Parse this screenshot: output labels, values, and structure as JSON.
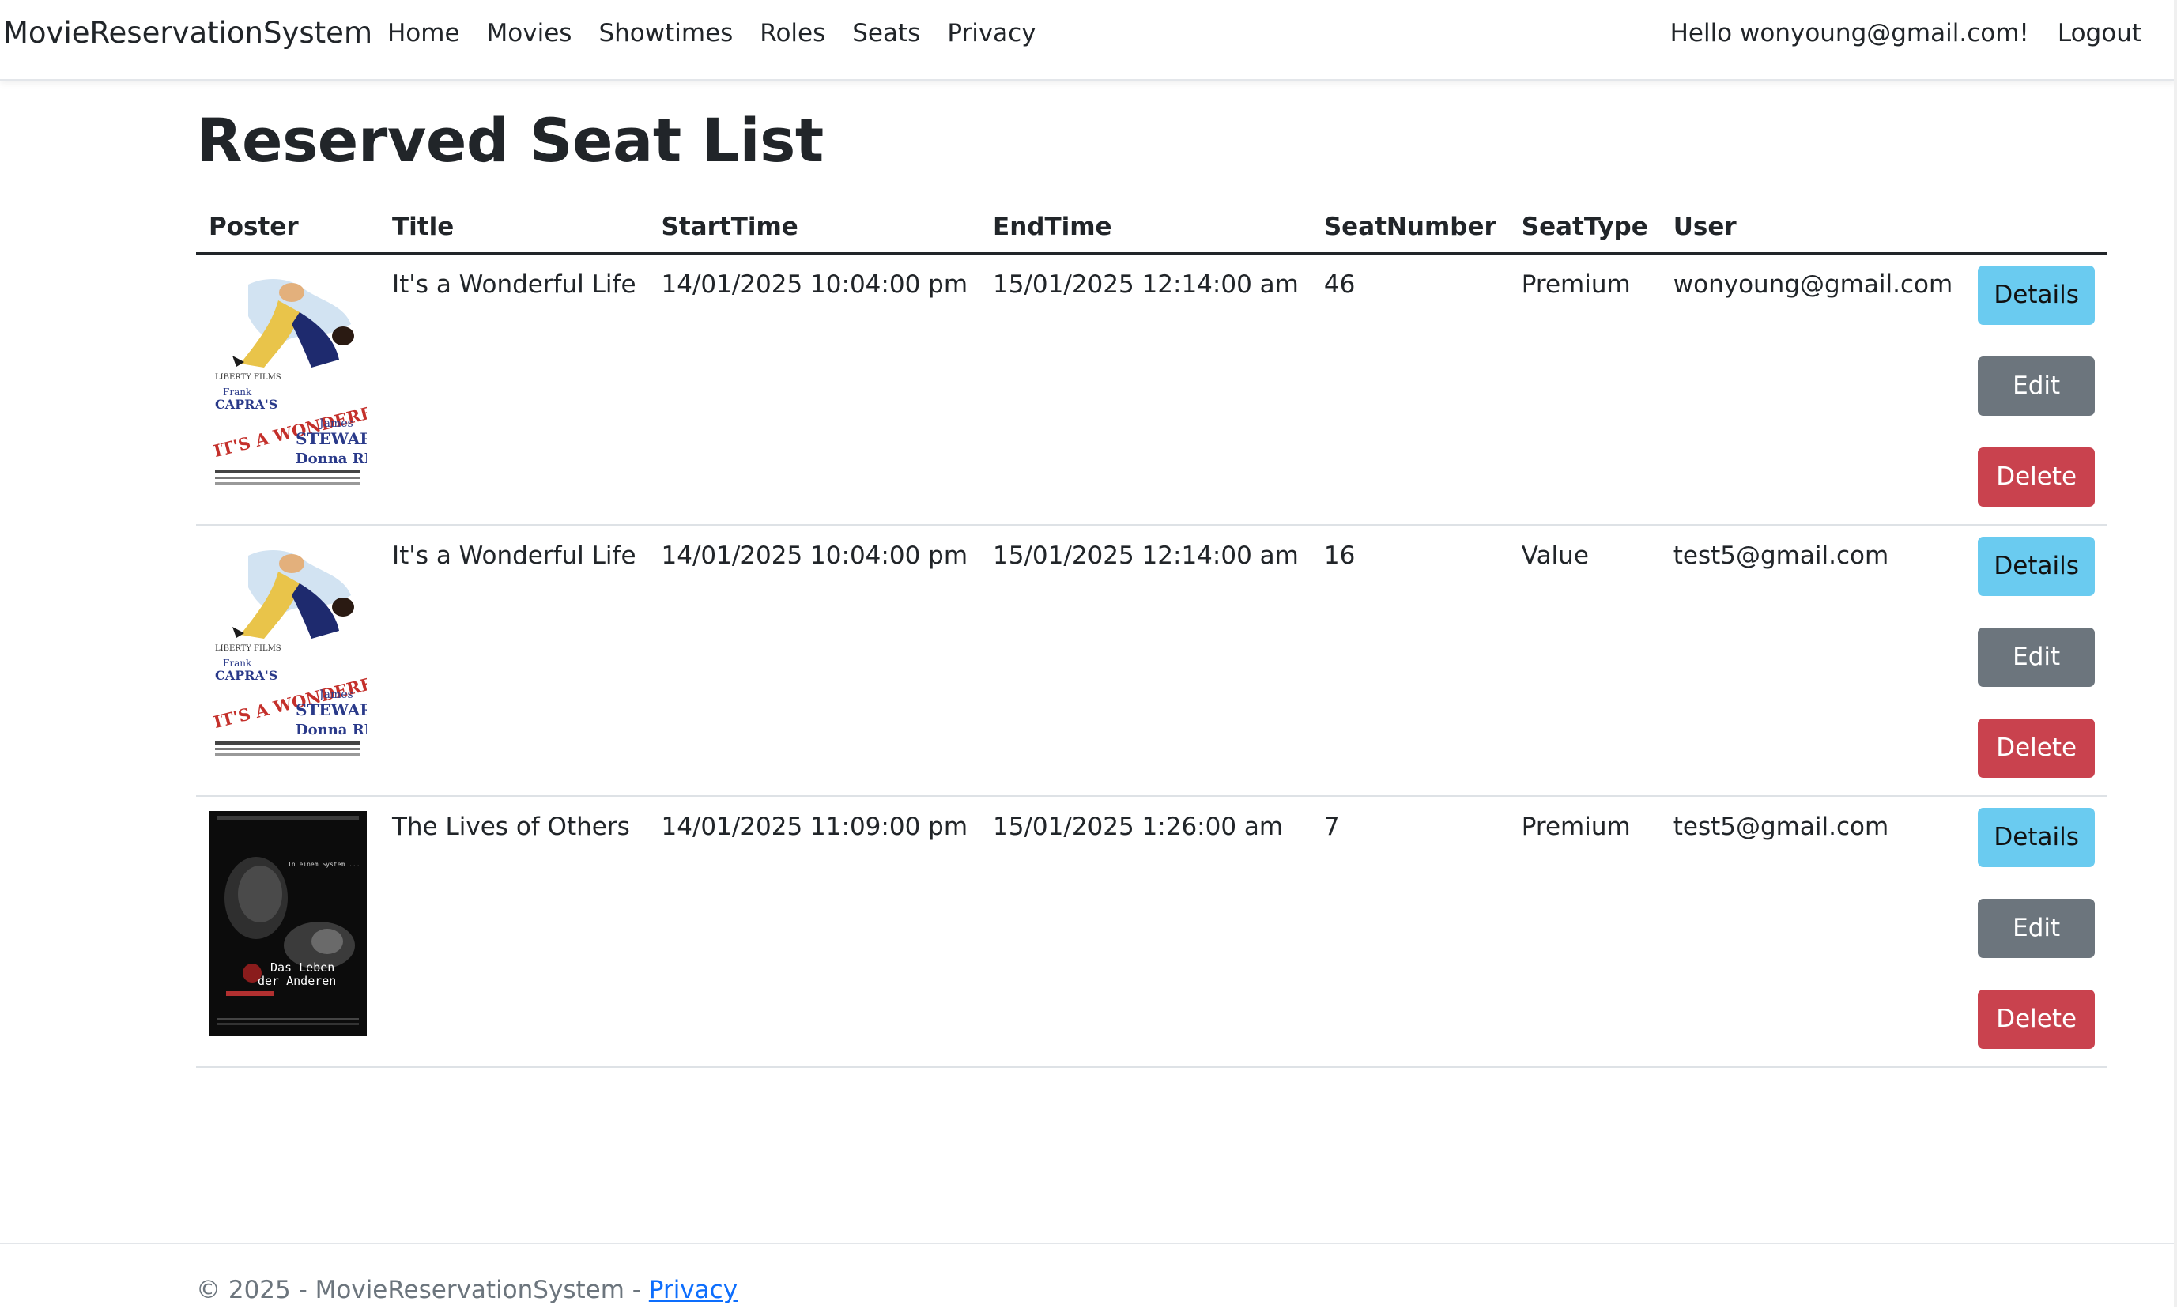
{
  "navbar": {
    "brand": "MovieReservationSystem",
    "links": [
      "Home",
      "Movies",
      "Showtimes",
      "Roles",
      "Seats",
      "Privacy"
    ],
    "greeting": "Hello wonyoung@gmail.com!",
    "logout": "Logout"
  },
  "page": {
    "title": "Reserved Seat List"
  },
  "table": {
    "headers": [
      "Poster",
      "Title",
      "StartTime",
      "EndTime",
      "SeatNumber",
      "SeatType",
      "User"
    ],
    "rows": [
      {
        "poster_icon": "its-a-wonderful-life-poster",
        "title": "It's a Wonderful Life",
        "start": "14/01/2025 10:04:00 pm",
        "end": "15/01/2025 12:14:00 am",
        "seat_number": "46",
        "seat_type": "Premium",
        "user": "wonyoung@gmail.com"
      },
      {
        "poster_icon": "its-a-wonderful-life-poster",
        "title": "It's a Wonderful Life",
        "start": "14/01/2025 10:04:00 pm",
        "end": "15/01/2025 12:14:00 am",
        "seat_number": "16",
        "seat_type": "Value",
        "user": "test5@gmail.com"
      },
      {
        "poster_icon": "the-lives-of-others-poster",
        "title": "The Lives of Others",
        "start": "14/01/2025 11:09:00 pm",
        "end": "15/01/2025 1:26:00 am",
        "seat_number": "7",
        "seat_type": "Premium",
        "user": "test5@gmail.com"
      }
    ],
    "actions": {
      "details": "Details",
      "edit": "Edit",
      "delete": "Delete"
    }
  },
  "posters": {
    "wonderful": {
      "line1": "LIBERTY FILMS",
      "line2": "Frank",
      "line3": "CAPRA'S",
      "line4": "IT'S A WONDERFUL LIFE",
      "line5": "James",
      "line6": "STEWART",
      "line7": "Donna REED"
    },
    "lives": {
      "line1": "Das Leben",
      "line2": "der Anderen"
    }
  },
  "footer": {
    "copyright": "© 2025 - MovieReservationSystem - ",
    "privacy": "Privacy"
  },
  "colors": {
    "details": "#6acbf0",
    "edit": "#6c757d",
    "delete": "#c9424e",
    "link": "#0d6efd"
  }
}
